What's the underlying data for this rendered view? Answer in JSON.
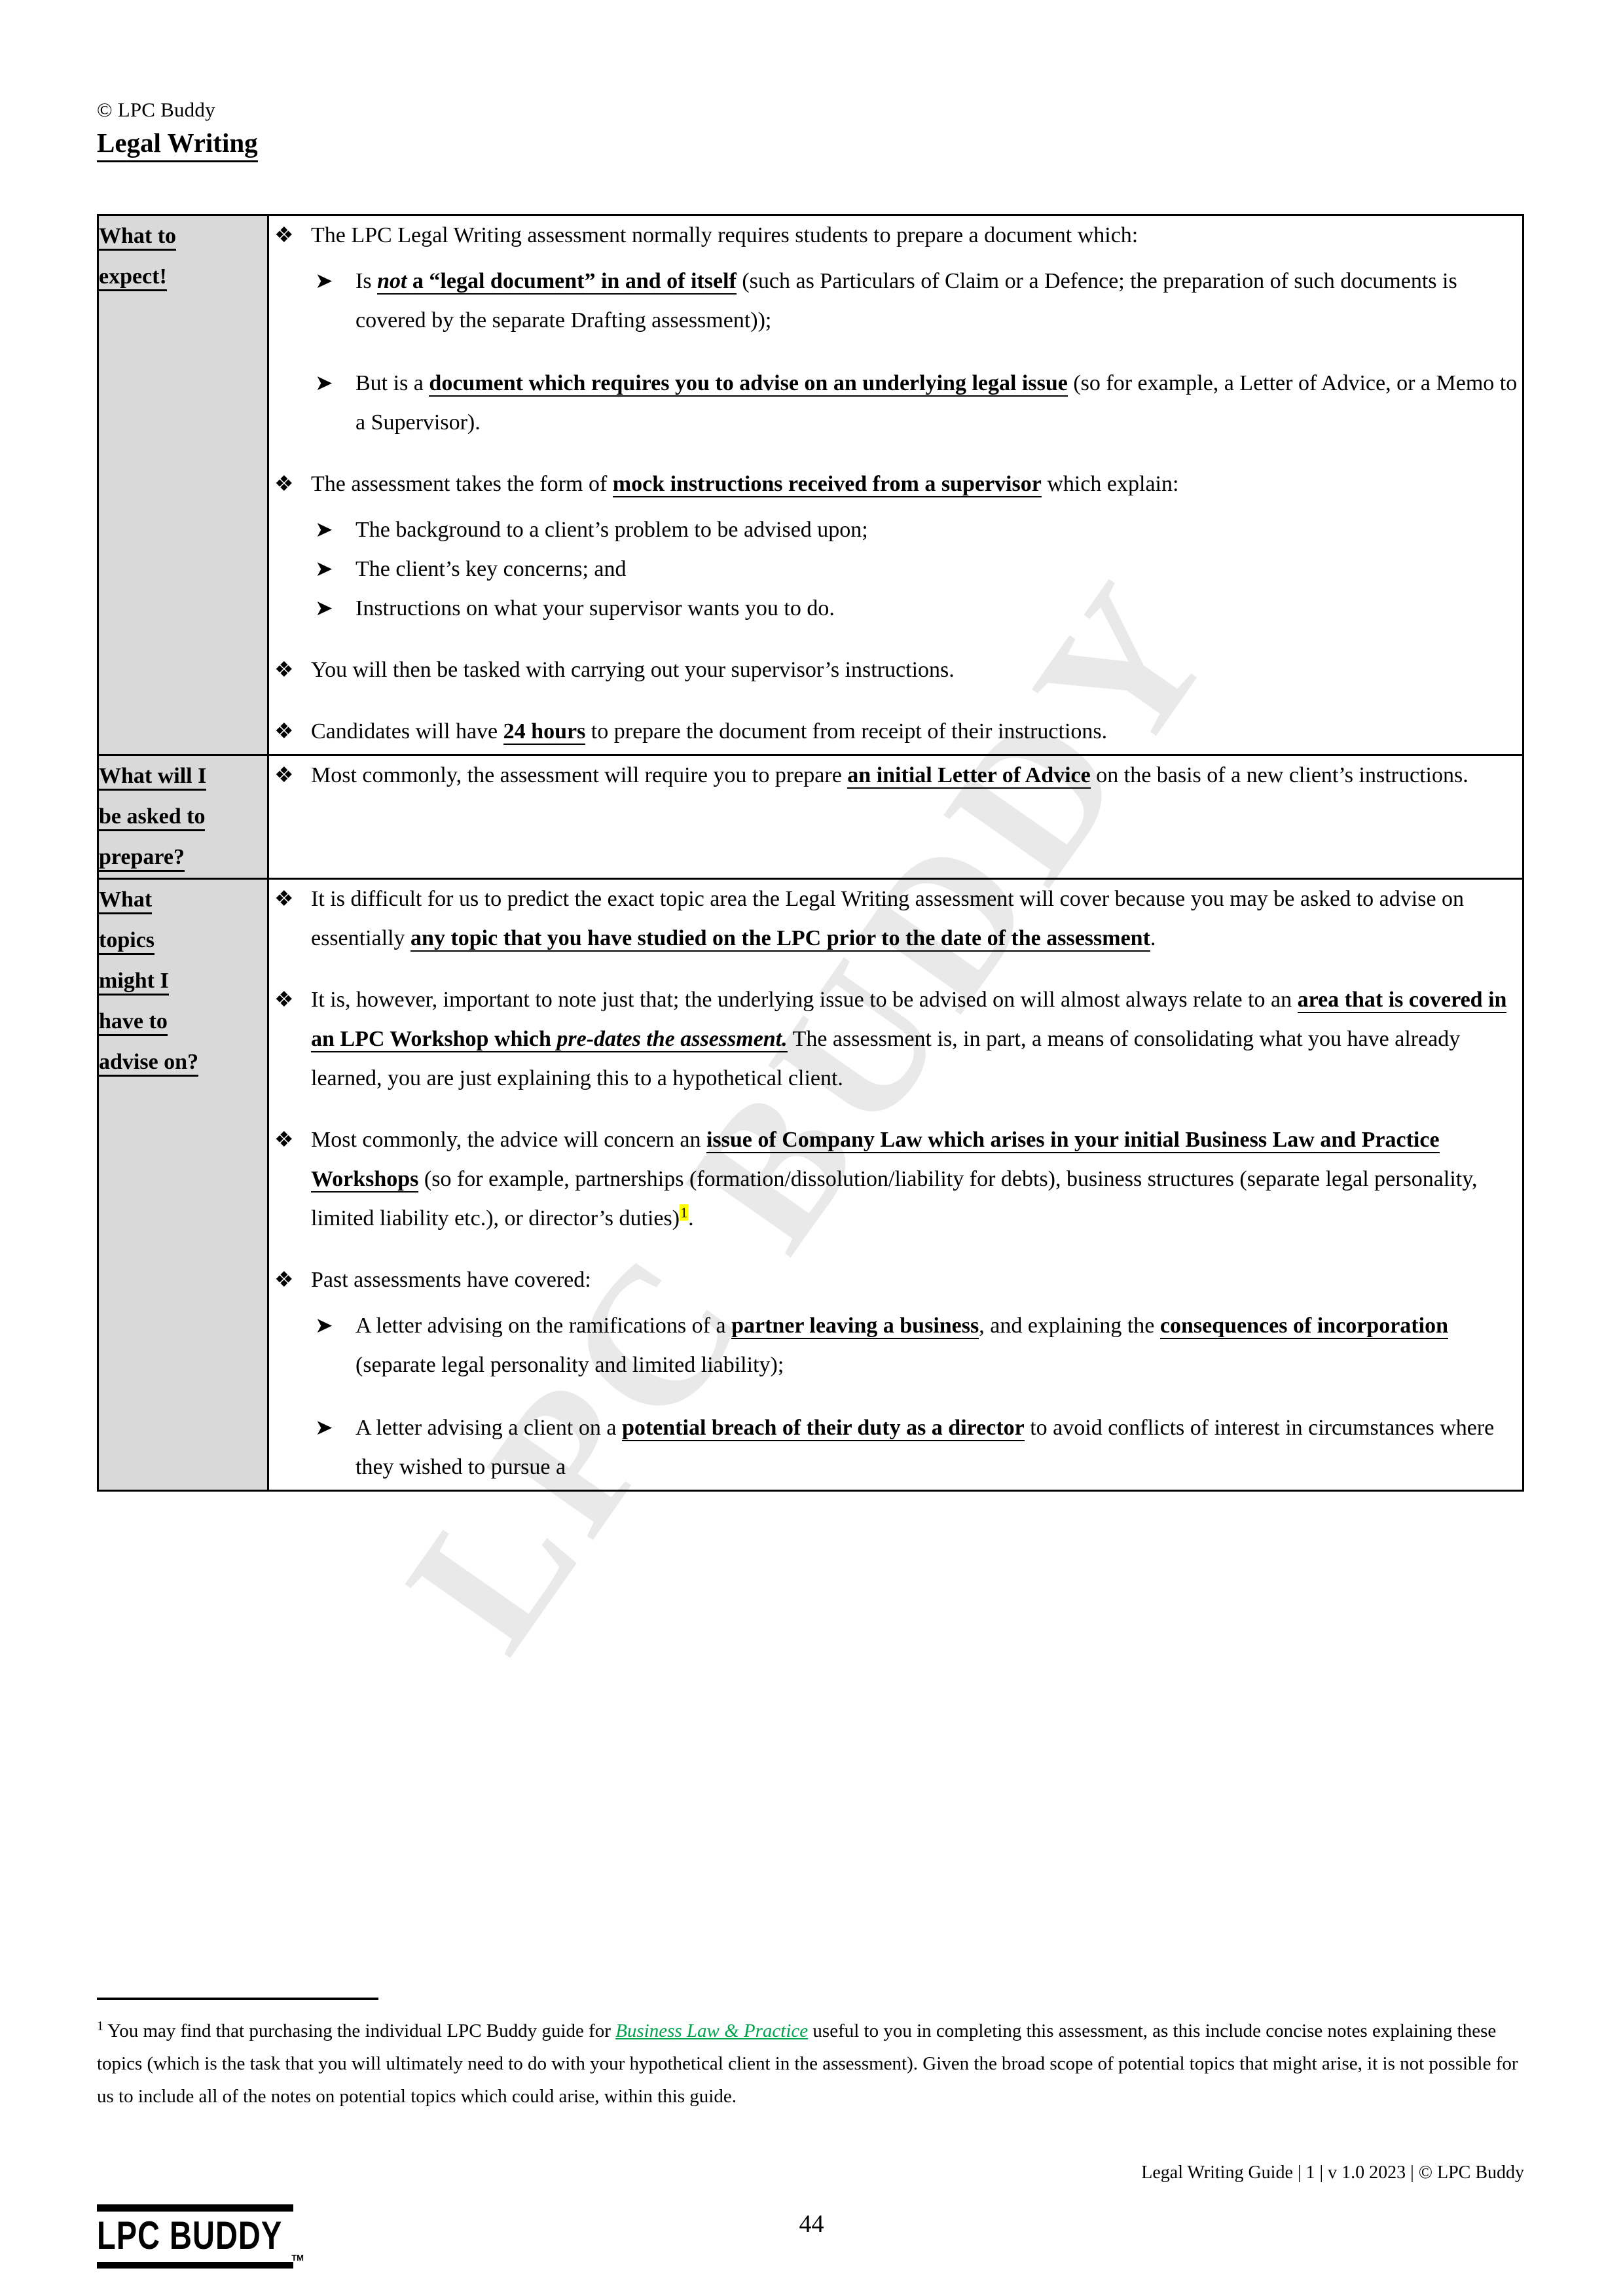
{
  "header": {
    "copyright_line": "© LPC Buddy",
    "document_title": "Legal Writing"
  },
  "colors": {
    "label_cell_background": "#D9D9D9",
    "table_border": "#000000",
    "link_green": "#00A24C",
    "highlight_yellow": "#FFFF00",
    "watermark_gray": "#E9E9E9"
  },
  "watermark": {
    "text": "LPC BUDDY"
  },
  "icons": {
    "level1_bullet": "❖",
    "level2_bullet": "➢"
  },
  "table": {
    "rows": [
      {
        "label": "What to expect!",
        "label_lines": [
          "What to",
          "expect!"
        ],
        "bullets": [
          {
            "text_html": "The LPC Legal Writing assessment normally requires students to prepare a document which:",
            "sub_bullets": [
              "Is <i>not</i> a “legal document” in and of itself (such as Particulars of Claim or a Defence; the preparation of such documents is covered by the separate Drafting assessment));",
              "But is a document which requires you to advise on an underlying legal issue (so for example, a Letter of Advice, or a Memo to a Supervisor)."
            ]
          },
          {
            "text_html": "The assessment takes the form of mock instructions received from a supervisor which explain:",
            "sub_bullets": [
              "The background to a client’s problem to be advised upon;",
              "The client’s key concerns; and",
              "Instructions on what your supervisor wants you to do."
            ]
          },
          {
            "text_html": "You will then be tasked with carrying out your supervisor’s instructions.",
            "sub_bullets": []
          },
          {
            "text_html": "Candidates will have 24 hours to prepare the document from receipt of their instructions.",
            "sub_bullets": []
          }
        ]
      },
      {
        "label": "What will I be asked to prepare?",
        "label_lines": [
          "What will I",
          "be asked to",
          "prepare?"
        ],
        "bullets": [
          {
            "text_html": "Most commonly, the assessment will require you to prepare an initial Letter of Advice on the basis of a new client’s instructions.",
            "sub_bullets": []
          }
        ]
      },
      {
        "label": "What topics might I have to advise on?",
        "label_lines": [
          "What",
          "topics",
          "might I",
          "have to",
          "advise on?"
        ],
        "bullets": [
          {
            "text_html": "It is difficult for us to predict the exact topic area the Legal Writing assessment will cover because you may be asked to advise on essentially any topic that you have studied on the LPC prior to the date of the assessment.",
            "sub_bullets": []
          },
          {
            "text_html": "It is, however, important to note just that; the underlying issue to be advised on will almost always relate to an area that is covered in an LPC Workshop which pre-dates the assessment. The assessment is, in part, a means of consolidating what you have already learned, you are just explaining this to a hypothetical client.",
            "sub_bullets": []
          },
          {
            "text_html": "Most commonly, the advice will concern an issue of Company Law which arises in your initial Business Law and Practice Workshops (so for example, partnerships (formation/dissolution/liability for debts), business structures (separate legal personality, limited liability etc.), or director’s duties)1.",
            "sub_bullets": []
          },
          {
            "text_html": "Past assessments have covered:",
            "sub_bullets": [
              "A letter advising on the ramifications of a partner leaving a business, and explaining the consequences of incorporation (separate legal personality and limited liability);",
              "A letter advising a client on a potential breach of their duty as a director to avoid conflicts of interest in circumstances where they wished to pursue a"
            ]
          }
        ]
      }
    ]
  },
  "footnote": {
    "marker": "1",
    "part1": " You may find that purchasing the individual LPC Buddy guide for ",
    "link_text": "Business Law & Practice",
    "part2": " useful to you in completing this assessment, as this include concise notes explaining these topics (which is the task that you will ultimately need to do with your hypothetical client in the assessment). Given the broad scope of potential topics that might arise, it is not possible for us to include all of the notes on potential topics which could arise, within this guide."
  },
  "page_footer": {
    "text": "Legal Writing Guide | 1 | v 1.0 2023 | © LPC Buddy"
  },
  "bottom": {
    "logo_text": "LPC  BUDDY",
    "logo_tm": "TM",
    "page_number": "44"
  }
}
